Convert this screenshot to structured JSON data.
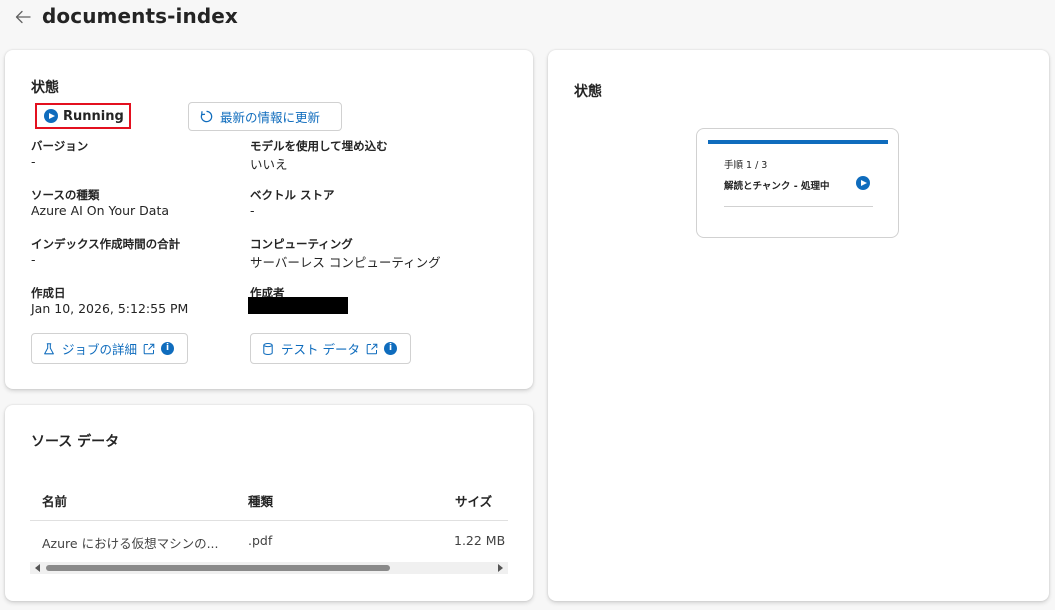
{
  "header": {
    "title": "documents-index"
  },
  "status_card": {
    "title": "状態",
    "status": "Running",
    "refresh_label": "最新の情報に更新",
    "fields": [
      {
        "label": "バージョン",
        "value": "-"
      },
      {
        "label": "モデルを使用して埋め込む",
        "value": "いいえ"
      },
      {
        "label": "ソースの種類",
        "value": "Azure AI On Your Data"
      },
      {
        "label": "ベクトル ストア",
        "value": "-"
      },
      {
        "label": "インデックス作成時間の合計",
        "value": "-"
      },
      {
        "label": "コンピューティング",
        "value": "サーバーレス コンピューティング"
      },
      {
        "label": "作成日",
        "value": "Jan 10, 2026, 5:12:55 PM"
      },
      {
        "label": "作成者",
        "value": ""
      }
    ],
    "job_details_label": "ジョブの詳細",
    "test_data_label": "テスト データ",
    "info_glyph": "i"
  },
  "source_card": {
    "title": "ソース データ",
    "columns": [
      "名前",
      "種類",
      "サイズ"
    ],
    "rows": [
      {
        "name": "Azure における仮想マシンの...",
        "type": ".pdf",
        "size": "1.22 MB"
      }
    ]
  },
  "progress_card": {
    "title": "状態",
    "step_count": "手順 1 / 3",
    "step_name": "解読とチャンク - 処理中"
  },
  "colors": {
    "accent": "#0f6cbd",
    "highlight_border": "#e3101f"
  }
}
